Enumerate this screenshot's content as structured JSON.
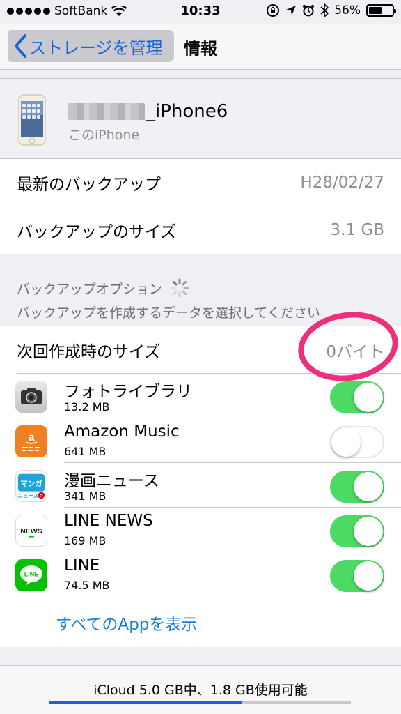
{
  "status": {
    "carrier": "SoftBank",
    "time": "10:33",
    "battery": "56%",
    "battery_level": 0.56
  },
  "nav": {
    "back_label": "ストレージを管理",
    "title": "情報"
  },
  "device": {
    "name_suffix": "_iPhone6",
    "subtitle": "このiPhone"
  },
  "backup_info": [
    {
      "label": "最新のバックアップ",
      "value": "H28/02/27"
    },
    {
      "label": "バックアップのサイズ",
      "value": "3.1 GB"
    }
  ],
  "backup_options": {
    "header": "バックアップオプション",
    "subheader": "バックアップを作成するデータを選択してください",
    "next_size_label": "次回作成時のサイズ",
    "next_size_value": "0バイト"
  },
  "apps": [
    {
      "name": "フォトライブラリ",
      "size": "13.2 MB",
      "enabled": true,
      "icon": "camera-icon"
    },
    {
      "name": "Amazon Music",
      "size": "641 MB",
      "enabled": false,
      "icon": "amazon-music-icon"
    },
    {
      "name": "漫画ニュース",
      "size": "341 MB",
      "enabled": true,
      "icon": "manga-news-icon",
      "icon_text": "マンガ",
      "icon_subtext": "ニュース"
    },
    {
      "name": "LINE NEWS",
      "size": "169 MB",
      "enabled": true,
      "icon": "line-news-icon",
      "icon_text": "NEWS"
    },
    {
      "name": "LINE",
      "size": "74.5 MB",
      "enabled": true,
      "icon": "line-icon",
      "icon_text": "LINE"
    }
  ],
  "show_all_label": "すべてのAppを表示",
  "storage": {
    "text": "iCloud 5.0 GB中、1.8 GB使用可能",
    "used_fraction": 0.64
  },
  "colors": {
    "accent": "#1a63d9",
    "toggle_on": "#4cd964",
    "highlight": "#ee2f7b"
  }
}
